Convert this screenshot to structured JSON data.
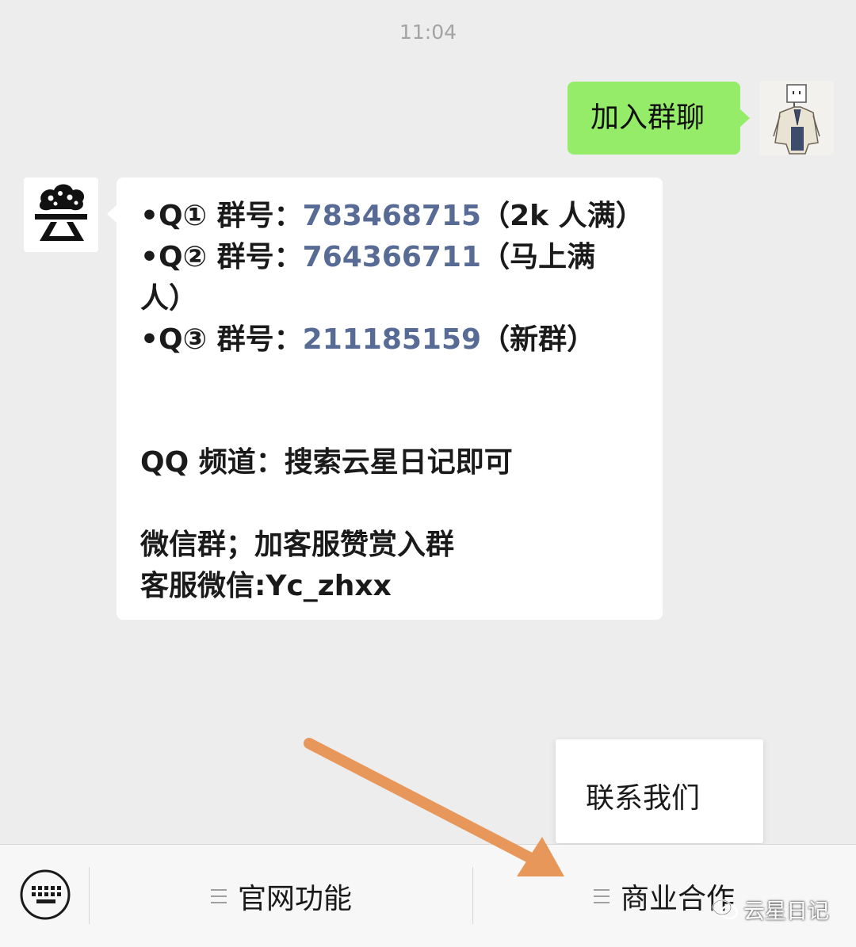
{
  "chat": {
    "time": "11:04",
    "outgoing_text": "加入群聊",
    "incoming": {
      "q1_prefix": "•Q① 群号：",
      "q1_number": "783468715",
      "q1_suffix": "（2k 人满）",
      "q2_prefix": "•Q② 群号：",
      "q2_number": "764366711",
      "q2_suffix": "（马上满",
      "q2_suffix_cont": "人）",
      "q3_prefix": "•Q③ 群号：",
      "q3_number": "211185159",
      "q3_suffix": "（新群）",
      "qq_channel": "QQ 频道：搜索云星日记即可",
      "wechat_group": "微信群；加客服赞赏入群",
      "service_wechat": "客服微信:Yc_zhxx"
    }
  },
  "popup": {
    "item": "联系我们"
  },
  "bottom_bar": {
    "menu_1": "官网功能",
    "menu_2": "商业合作"
  },
  "watermark": {
    "text": "云星日记"
  },
  "colors": {
    "outgoing_bubble": "#95ec69",
    "link_number": "#576b95",
    "arrow": "#e8975a"
  }
}
